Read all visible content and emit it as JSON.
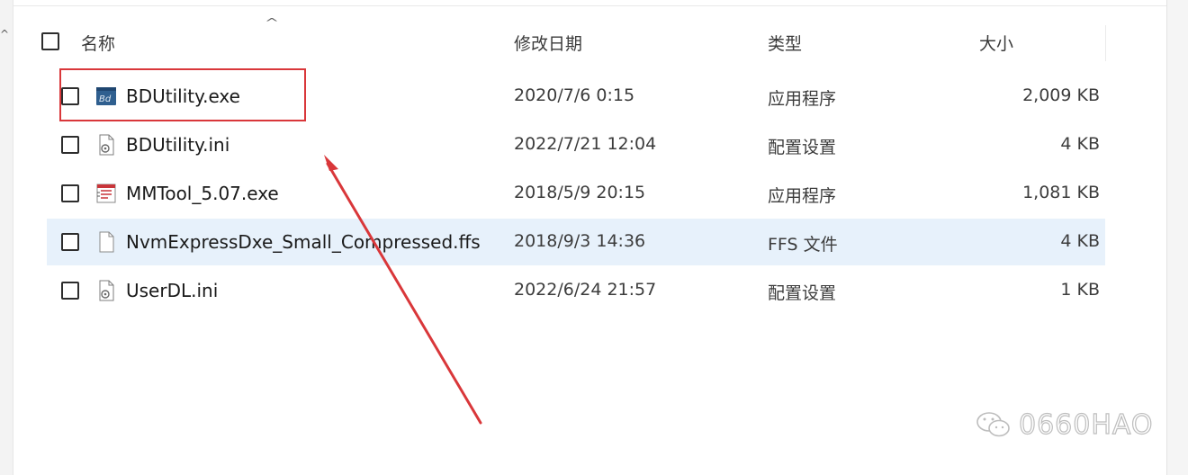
{
  "header": {
    "name": "名称",
    "date": "修改日期",
    "type": "类型",
    "size": "大小",
    "sort_indicator": "^"
  },
  "files": [
    {
      "name": "BDUtility.exe",
      "date": "2020/7/6 0:15",
      "type": "应用程序",
      "size": "2,009 KB",
      "icon": "bd-app-icon",
      "selected": false
    },
    {
      "name": "BDUtility.ini",
      "date": "2022/7/21 12:04",
      "type": "配置设置",
      "size": "4 KB",
      "icon": "ini-settings-icon",
      "selected": false
    },
    {
      "name": "MMTool_5.07.exe",
      "date": "2018/5/9 20:15",
      "type": "应用程序",
      "size": "1,081 KB",
      "icon": "mmtool-app-icon",
      "selected": false
    },
    {
      "name": "NvmExpressDxe_Small_Compressed.ffs",
      "date": "2018/9/3 14:36",
      "type": "FFS 文件",
      "size": "4 KB",
      "icon": "blank-file-icon",
      "selected": true
    },
    {
      "name": "UserDL.ini",
      "date": "2022/6/24 21:57",
      "type": "配置设置",
      "size": "1 KB",
      "icon": "ini-settings-icon",
      "selected": false
    }
  ],
  "annotation": {
    "highlight_color": "#d9373a",
    "arrow_color": "#d9373a"
  },
  "watermark": {
    "text": "0660HAO",
    "icon": "wechat-icon"
  },
  "colors": {
    "selection": "#e7f1fb",
    "bd_icon": "#2f5f8f"
  }
}
